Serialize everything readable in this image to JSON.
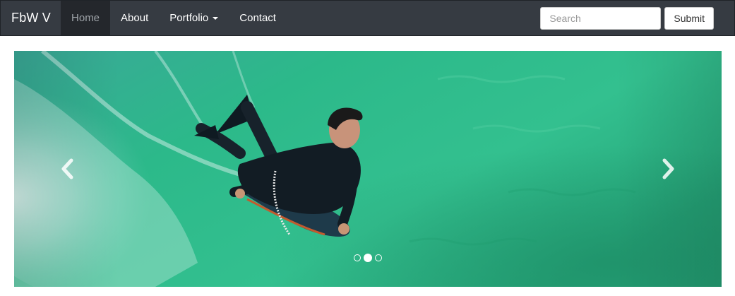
{
  "navbar": {
    "brand": "FbW V",
    "items": [
      {
        "label": "Home",
        "active": true
      },
      {
        "label": "About",
        "active": false
      },
      {
        "label": "Portfolio",
        "active": false,
        "dropdown": true
      },
      {
        "label": "Contact",
        "active": false
      }
    ],
    "search": {
      "placeholder": "Search",
      "value": ""
    },
    "submit_label": "Submit"
  },
  "carousel": {
    "slide_count": 3,
    "active_index": 1,
    "image_subject": "bodyboarder riding a green ocean wave",
    "controls": {
      "prev_icon": "chevron-left-icon",
      "next_icon": "chevron-right-icon"
    }
  },
  "colors": {
    "navbar_bg": "#363b42",
    "navbar_active_bg": "#24272c",
    "water_green": "#2bb583"
  }
}
